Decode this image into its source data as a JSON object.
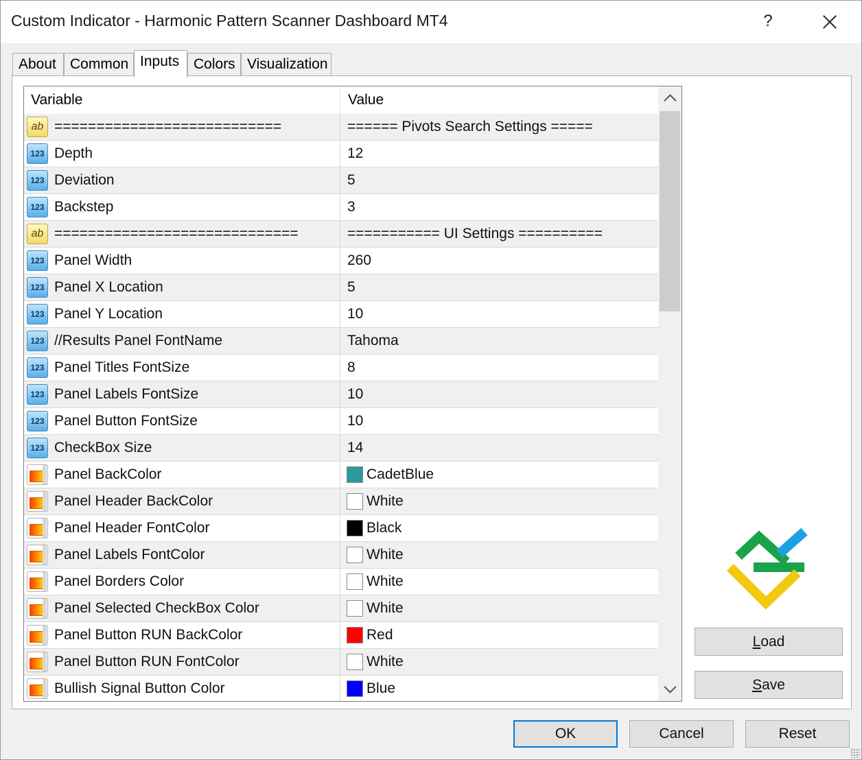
{
  "window": {
    "title": "Custom Indicator - Harmonic Pattern Scanner Dashboard MT4",
    "help_label": "?"
  },
  "tabs": [
    {
      "label": "About",
      "active": false
    },
    {
      "label": "Common",
      "active": false
    },
    {
      "label": "Inputs",
      "active": true
    },
    {
      "label": "Colors",
      "active": false
    },
    {
      "label": "Visualization",
      "active": false
    }
  ],
  "grid": {
    "headers": {
      "variable": "Variable",
      "value": "Value"
    },
    "rows": [
      {
        "icon": "ab",
        "variable": "===========================",
        "value": "======  Pivots Search Settings  ====="
      },
      {
        "icon": "num",
        "variable": "Depth",
        "value": "12"
      },
      {
        "icon": "num",
        "variable": "Deviation",
        "value": "5"
      },
      {
        "icon": "num",
        "variable": "Backstep",
        "value": "3"
      },
      {
        "icon": "ab",
        "variable": "=============================",
        "value": "===========  UI Settings  =========="
      },
      {
        "icon": "num",
        "variable": "Panel Width",
        "value": "260"
      },
      {
        "icon": "num",
        "variable": "Panel X Location",
        "value": "5"
      },
      {
        "icon": "num",
        "variable": "Panel Y Location",
        "value": "10"
      },
      {
        "icon": "num",
        "variable": "//Results Panel FontName",
        "value": "Tahoma"
      },
      {
        "icon": "num",
        "variable": "Panel Titles FontSize",
        "value": "8"
      },
      {
        "icon": "num",
        "variable": "Panel Labels FontSize",
        "value": "10"
      },
      {
        "icon": "num",
        "variable": "Panel Button FontSize",
        "value": "10"
      },
      {
        "icon": "num",
        "variable": "CheckBox Size",
        "value": "14"
      },
      {
        "icon": "color",
        "variable": "Panel BackColor",
        "value": "CadetBlue",
        "swatch": "#2b9aa0"
      },
      {
        "icon": "color",
        "variable": "Panel Header BackColor",
        "value": "White",
        "swatch": "#ffffff"
      },
      {
        "icon": "color",
        "variable": "Panel Header FontColor",
        "value": "Black",
        "swatch": "#000000"
      },
      {
        "icon": "color",
        "variable": "Panel Labels FontColor",
        "value": "White",
        "swatch": "#ffffff"
      },
      {
        "icon": "color",
        "variable": "Panel Borders Color",
        "value": "White",
        "swatch": "#ffffff"
      },
      {
        "icon": "color",
        "variable": "Panel Selected CheckBox Color",
        "value": "White",
        "swatch": "#ffffff"
      },
      {
        "icon": "color",
        "variable": "Panel Button RUN BackColor",
        "value": "Red",
        "swatch": "#ff0000"
      },
      {
        "icon": "color",
        "variable": "Panel Button RUN FontColor",
        "value": "White",
        "swatch": "#ffffff"
      },
      {
        "icon": "color",
        "variable": "Bullish Signal Button Color",
        "value": "Blue",
        "swatch": "#0000ff"
      }
    ]
  },
  "side_buttons": {
    "load": "Load",
    "save": "Save"
  },
  "footer_buttons": {
    "ok": "OK",
    "cancel": "Cancel",
    "reset": "Reset"
  },
  "colors": {
    "logo_green": "#1aa34a",
    "logo_blue": "#1ba1e2",
    "logo_yellow": "#f2c811",
    "focus_blue": "#0078d7"
  }
}
